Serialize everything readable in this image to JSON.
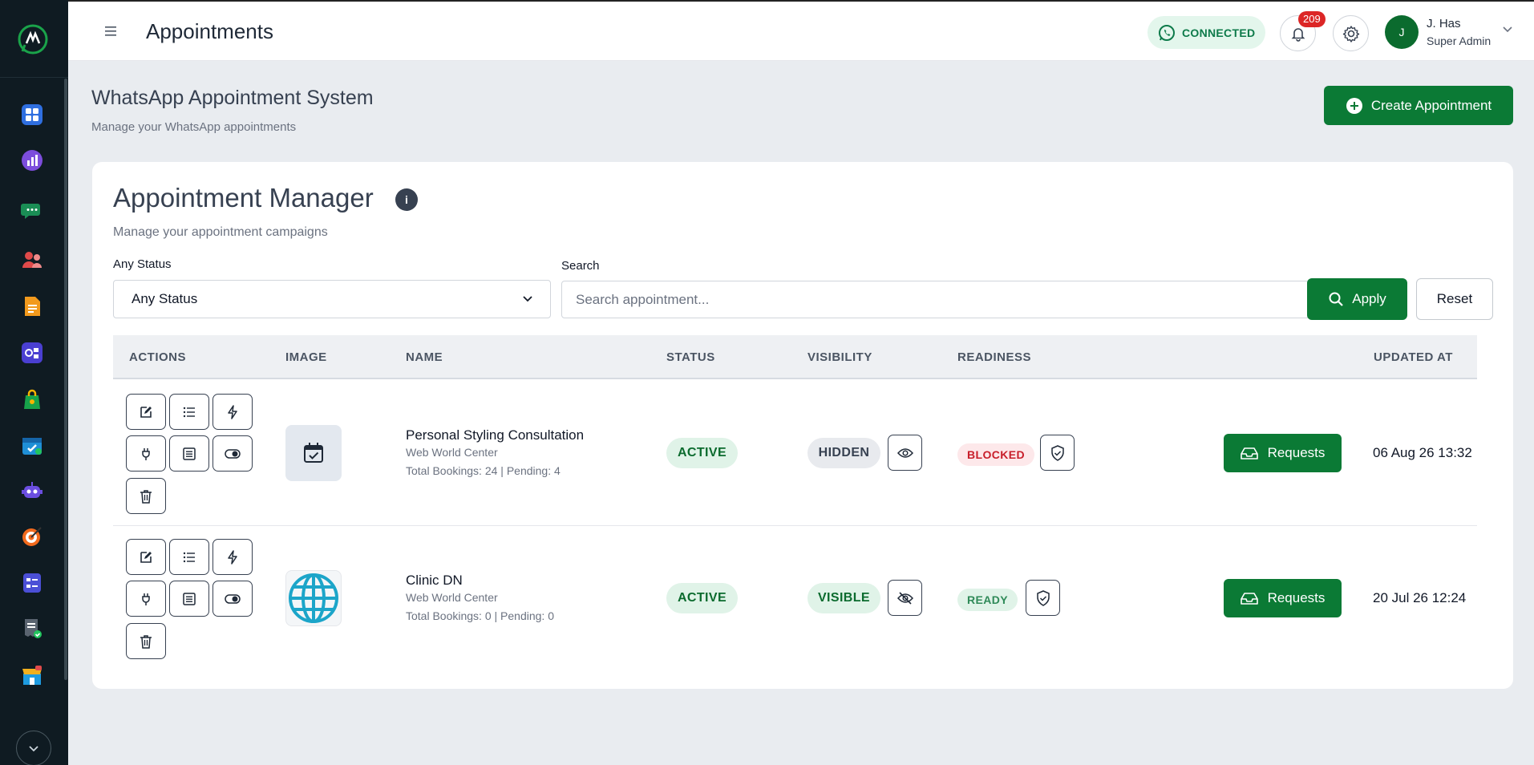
{
  "header": {
    "title": "Appointments",
    "connection_status": "CONNECTED",
    "notification_count": "209",
    "user": {
      "initial": "J",
      "name": "J. Has",
      "role": "Super Admin"
    }
  },
  "page": {
    "title": "WhatsApp Appointment System",
    "subtitle": "Manage your WhatsApp appointments",
    "create_button": "Create Appointment"
  },
  "card": {
    "title": "Appointment Manager",
    "info_label": "i",
    "subtitle": "Manage your appointment campaigns",
    "status_filter": {
      "label": "Any Status",
      "selected": "Any Status"
    },
    "search": {
      "label": "Search",
      "placeholder": "Search appointment..."
    },
    "apply_button": "Apply",
    "reset_button": "Reset"
  },
  "table": {
    "columns": [
      "ACTIONS",
      "IMAGE",
      "NAME",
      "STATUS",
      "VISIBILITY",
      "READINESS",
      "UPDATED AT"
    ],
    "rows": [
      {
        "name": "Personal Styling Consultation",
        "org": "Web World Center",
        "stats": "Total Bookings: 24 | Pending: 4",
        "status": "ACTIVE",
        "visibility": "HIDDEN",
        "readiness": "BLOCKED",
        "requests_label": "Requests",
        "updated_at": "06 Aug 26 13:32",
        "image": "calendar-check-icon"
      },
      {
        "name": "Clinic DN",
        "org": "Web World Center",
        "stats": "Total Bookings: 0 | Pending: 0",
        "status": "ACTIVE",
        "visibility": "VISIBLE",
        "readiness": "READY",
        "requests_label": "Requests",
        "updated_at": "20 Jul 26 12:24",
        "image": "globe-icon"
      }
    ]
  },
  "colors": {
    "brand_green": "#0b7a35",
    "sidebar_bg": "#0f1b22",
    "danger": "#dc2626"
  }
}
